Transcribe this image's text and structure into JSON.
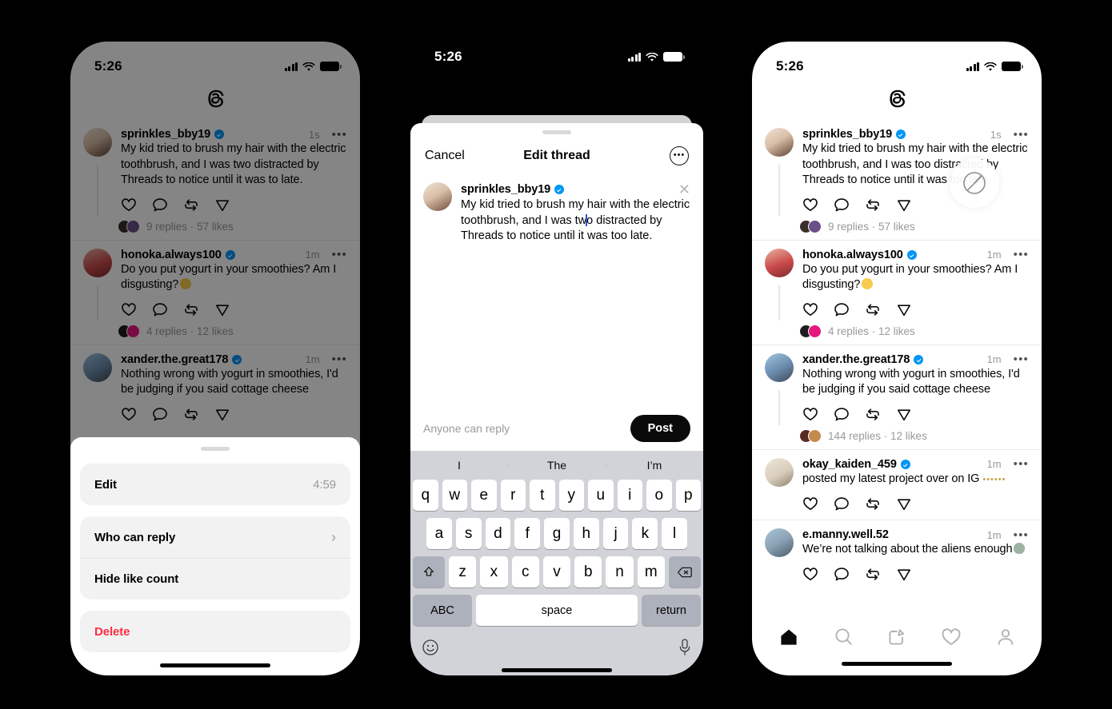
{
  "status_bar": {
    "time": "5:26",
    "signal_icon": "cellular-bars-icon",
    "wifi_icon": "wifi-icon",
    "battery_icon": "battery-full-icon"
  },
  "app": {
    "name": "Threads",
    "logo_icon": "threads-logo-icon"
  },
  "phone1": {
    "label": "Threads feed with post options sheet",
    "sheet": {
      "grabber": "sheet-grabber",
      "options": [
        {
          "label": "Edit",
          "value": "4:59",
          "type": "timer"
        },
        {
          "label": "Who can reply",
          "value": "",
          "type": "chevron"
        },
        {
          "label": "Hide like count",
          "value": "",
          "type": "plain"
        },
        {
          "label": "Delete",
          "value": "",
          "type": "danger"
        }
      ]
    }
  },
  "phone2": {
    "label": "Edit thread compose sheet with keyboard",
    "header": {
      "cancel": "Cancel",
      "title": "Edit thread",
      "more_icon": "more-circle-icon"
    },
    "editor": {
      "username": "sprinkles_bby19",
      "verified": true,
      "text_before_caret": "My kid tried to brush my hair with the electric toothbrush, and I was tw",
      "text_after_caret": "o distracted by Threads to notice until it was too late.",
      "close_icon": "close-icon"
    },
    "footer": {
      "reply_policy": "Anyone can reply",
      "post_label": "Post"
    },
    "keyboard": {
      "suggestions": [
        "I",
        "The",
        "I’m"
      ],
      "row1": [
        "q",
        "w",
        "e",
        "r",
        "t",
        "y",
        "u",
        "i",
        "o",
        "p"
      ],
      "row2": [
        "a",
        "s",
        "d",
        "f",
        "g",
        "h",
        "j",
        "k",
        "l"
      ],
      "row3": [
        "z",
        "x",
        "c",
        "v",
        "b",
        "n",
        "m"
      ],
      "shift_icon": "shift-icon",
      "backspace_icon": "backspace-icon",
      "abc_label": "ABC",
      "space_label": "space",
      "return_label": "return",
      "emoji_icon": "emoji-smiley-icon",
      "mic_icon": "microphone-icon"
    }
  },
  "phone3": {
    "label": "Threads feed after edit",
    "cursor_overlay_icon": "cursor-ring-icon",
    "nav": [
      {
        "name": "home",
        "icon": "home-icon",
        "active": true
      },
      {
        "name": "search",
        "icon": "search-icon",
        "active": false
      },
      {
        "name": "compose",
        "icon": "compose-icon",
        "active": false
      },
      {
        "name": "activity",
        "icon": "heart-icon",
        "active": false
      },
      {
        "name": "profile",
        "icon": "person-icon",
        "active": false
      }
    ]
  },
  "post_actions": [
    "like-icon",
    "reply-icon",
    "repost-icon",
    "share-icon"
  ],
  "feed_before": [
    {
      "username": "sprinkles_bby19",
      "verified": true,
      "time": "1s",
      "text": "My kid tried to brush my hair with the electric toothbrush, and I was two distracted by Threads to notice until it was to late.",
      "meta": "9 replies · 57 likes",
      "faces": 2,
      "avatar_color": "#e7d6c6"
    },
    {
      "username": "honoka.always100",
      "verified": true,
      "time": "1m",
      "text": "Do you put yogurt in your smoothies? Am I disgusting?",
      "emoji": "neutral-face-emoji",
      "meta": "4 replies · 12 likes",
      "faces": 2,
      "avatar_color": "#c9494a"
    },
    {
      "username": "xander.the.great178",
      "verified": true,
      "time": "1m",
      "text": "Nothing wrong with yogurt in smoothies, I'd be judging if you said cottage cheese",
      "meta": "",
      "faces": 0,
      "avatar_color": "#6f8fb0"
    }
  ],
  "feed_after": [
    {
      "username": "sprinkles_bby19",
      "verified": true,
      "time": "1s",
      "text": "My kid tried to brush my hair with the electric toothbrush, and I was too distracted by Threads to notice until it was too late.",
      "meta": "9 replies · 57 likes",
      "faces": 2,
      "avatar_color": "#e7d6c6"
    },
    {
      "username": "honoka.always100",
      "verified": true,
      "time": "1m",
      "text": "Do you put yogurt in your smoothies? Am I disgusting?",
      "emoji": "neutral-face-emoji",
      "meta": "4 replies · 12 likes",
      "faces": 2,
      "avatar_color": "#c9494a"
    },
    {
      "username": "xander.the.great178",
      "verified": true,
      "time": "1m",
      "text": "Nothing wrong with yogurt in smoothies, I'd be judging if you said cottage cheese",
      "meta": "144 replies · 12 likes",
      "faces": 2,
      "avatar_color": "#6f8fb0"
    },
    {
      "username": "okay_kaiden_459",
      "verified": true,
      "time": "1m",
      "text": "posted my latest project over on IG",
      "trailing_dots": "••••••",
      "meta": "",
      "faces": 0,
      "avatar_color": "#d8cdbd"
    },
    {
      "username": "e.manny.well.52",
      "verified": false,
      "time": "1m",
      "text": "We’re not talking about the aliens enough",
      "emoji": "alien-emoji",
      "meta": "",
      "faces": 0,
      "avatar_color": "#8aa2b5"
    }
  ],
  "colors": {
    "verified_blue": "#0095f6",
    "danger_red": "#ff2d42",
    "accent_dark": "#0a0a0a",
    "muted": "#999999"
  }
}
